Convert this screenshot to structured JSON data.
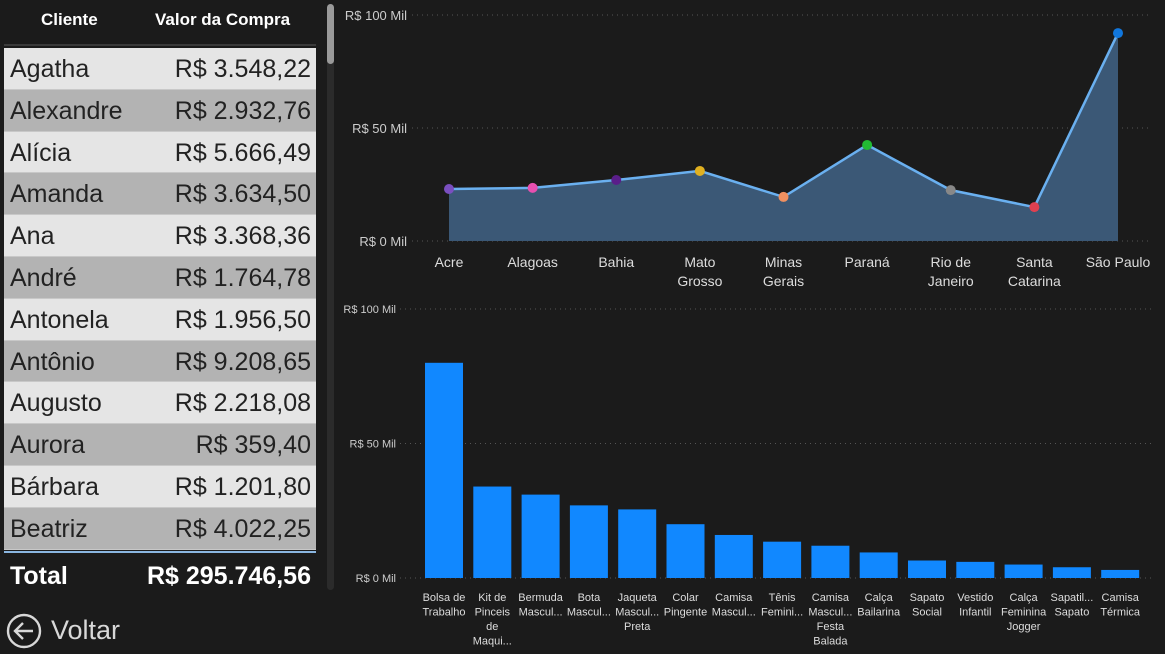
{
  "table": {
    "header_client": "Cliente",
    "header_value": "Valor da Compra",
    "rows": [
      {
        "name": "Agatha",
        "value": "R$ 3.548,22"
      },
      {
        "name": "Alexandre",
        "value": "R$ 2.932,76"
      },
      {
        "name": "Alícia",
        "value": "R$ 5.666,49"
      },
      {
        "name": "Amanda",
        "value": "R$ 3.634,50"
      },
      {
        "name": "Ana",
        "value": "R$ 3.368,36"
      },
      {
        "name": "André",
        "value": "R$ 1.764,78"
      },
      {
        "name": "Antonela",
        "value": "R$ 1.956,50"
      },
      {
        "name": "Antônio",
        "value": "R$ 9.208,65"
      },
      {
        "name": "Augusto",
        "value": "R$ 2.218,08"
      },
      {
        "name": "Aurora",
        "value": "R$ 359,40"
      },
      {
        "name": "Bárbara",
        "value": "R$ 1.201,80"
      },
      {
        "name": "Beatriz",
        "value": "R$ 4.022,25"
      }
    ],
    "total_label": "Total",
    "total_value": "R$ 295.746,56"
  },
  "back_button": {
    "label": "Voltar",
    "icon": "arrow-left-circle-icon"
  },
  "colors": {
    "area_fill": "#3b5876",
    "area_line": "#6ab0f0",
    "bar": "#1188ff",
    "gridline": "#555555"
  },
  "chart_data": [
    {
      "type": "area",
      "categories": [
        "Acre",
        "Alagoas",
        "Bahia",
        "Mato Grosso",
        "Minas Gerais",
        "Paraná",
        "Rio de Janeiro",
        "Santa Catarina",
        "São Paulo"
      ],
      "category_lines": [
        [
          "Acre"
        ],
        [
          "Alagoas"
        ],
        [
          "Bahia"
        ],
        [
          "Mato",
          "Grosso"
        ],
        [
          "Minas",
          "Gerais"
        ],
        [
          "Paraná"
        ],
        [
          "Rio de",
          "Janeiro"
        ],
        [
          "Santa",
          "Catarina"
        ],
        [
          "São Paulo"
        ]
      ],
      "values": [
        23000,
        23500,
        27000,
        31000,
        19500,
        42500,
        22500,
        15000,
        92000
      ],
      "point_colors": [
        "#7a4fc0",
        "#e84fb0",
        "#5a1e8a",
        "#e0b020",
        "#f09060",
        "#22bb33",
        "#888888",
        "#e04050",
        "#1177dd"
      ],
      "ylim": [
        0,
        100000
      ],
      "yticks": [
        0,
        50000,
        100000
      ],
      "ytick_labels": [
        "R$ 0 Mil",
        "R$ 50 Mil",
        "R$ 100 Mil"
      ],
      "grid": true
    },
    {
      "type": "bar",
      "categories": [
        "Bolsa de Trabalho",
        "Kit de Pinceis de Maqui...",
        "Bermuda Mascul...",
        "Bota Mascul...",
        "Jaqueta Mascul... Preta",
        "Colar Pingente",
        "Camisa Mascul...",
        "Tênis Femini...",
        "Camisa Mascul... Festa Balada",
        "Calça Bailarina",
        "Sapato Social",
        "Vestido Infantil",
        "Calça Feminina Jogger",
        "Sapatil... Sapato",
        "Camisa Térmica"
      ],
      "category_lines": [
        [
          "Bolsa de",
          "Trabalho"
        ],
        [
          "Kit de",
          "Pinceis",
          "de",
          "Maqui..."
        ],
        [
          "Bermuda",
          "Mascul..."
        ],
        [
          "Bota",
          "Mascul..."
        ],
        [
          "Jaqueta",
          "Mascul...",
          "Preta"
        ],
        [
          "Colar",
          "Pingente"
        ],
        [
          "Camisa",
          "Mascul..."
        ],
        [
          "Tênis",
          "Femini..."
        ],
        [
          "Camisa",
          "Mascul...",
          "Festa",
          "Balada"
        ],
        [
          "Calça",
          "Bailarina"
        ],
        [
          "Sapato",
          "Social"
        ],
        [
          "Vestido",
          "Infantil"
        ],
        [
          "Calça",
          "Feminina",
          "Jogger"
        ],
        [
          "Sapatil...",
          "Sapato"
        ],
        [
          "Camisa",
          "Térmica"
        ]
      ],
      "values": [
        80000,
        34000,
        31000,
        27000,
        25500,
        20000,
        16000,
        13500,
        12000,
        9500,
        6500,
        6000,
        5000,
        4000,
        3000
      ],
      "ylim": [
        0,
        100000
      ],
      "yticks": [
        0,
        50000,
        100000
      ],
      "ytick_labels": [
        "R$ 0 Mil",
        "R$ 50 Mil",
        "R$ 100 Mil"
      ],
      "grid": true
    }
  ]
}
